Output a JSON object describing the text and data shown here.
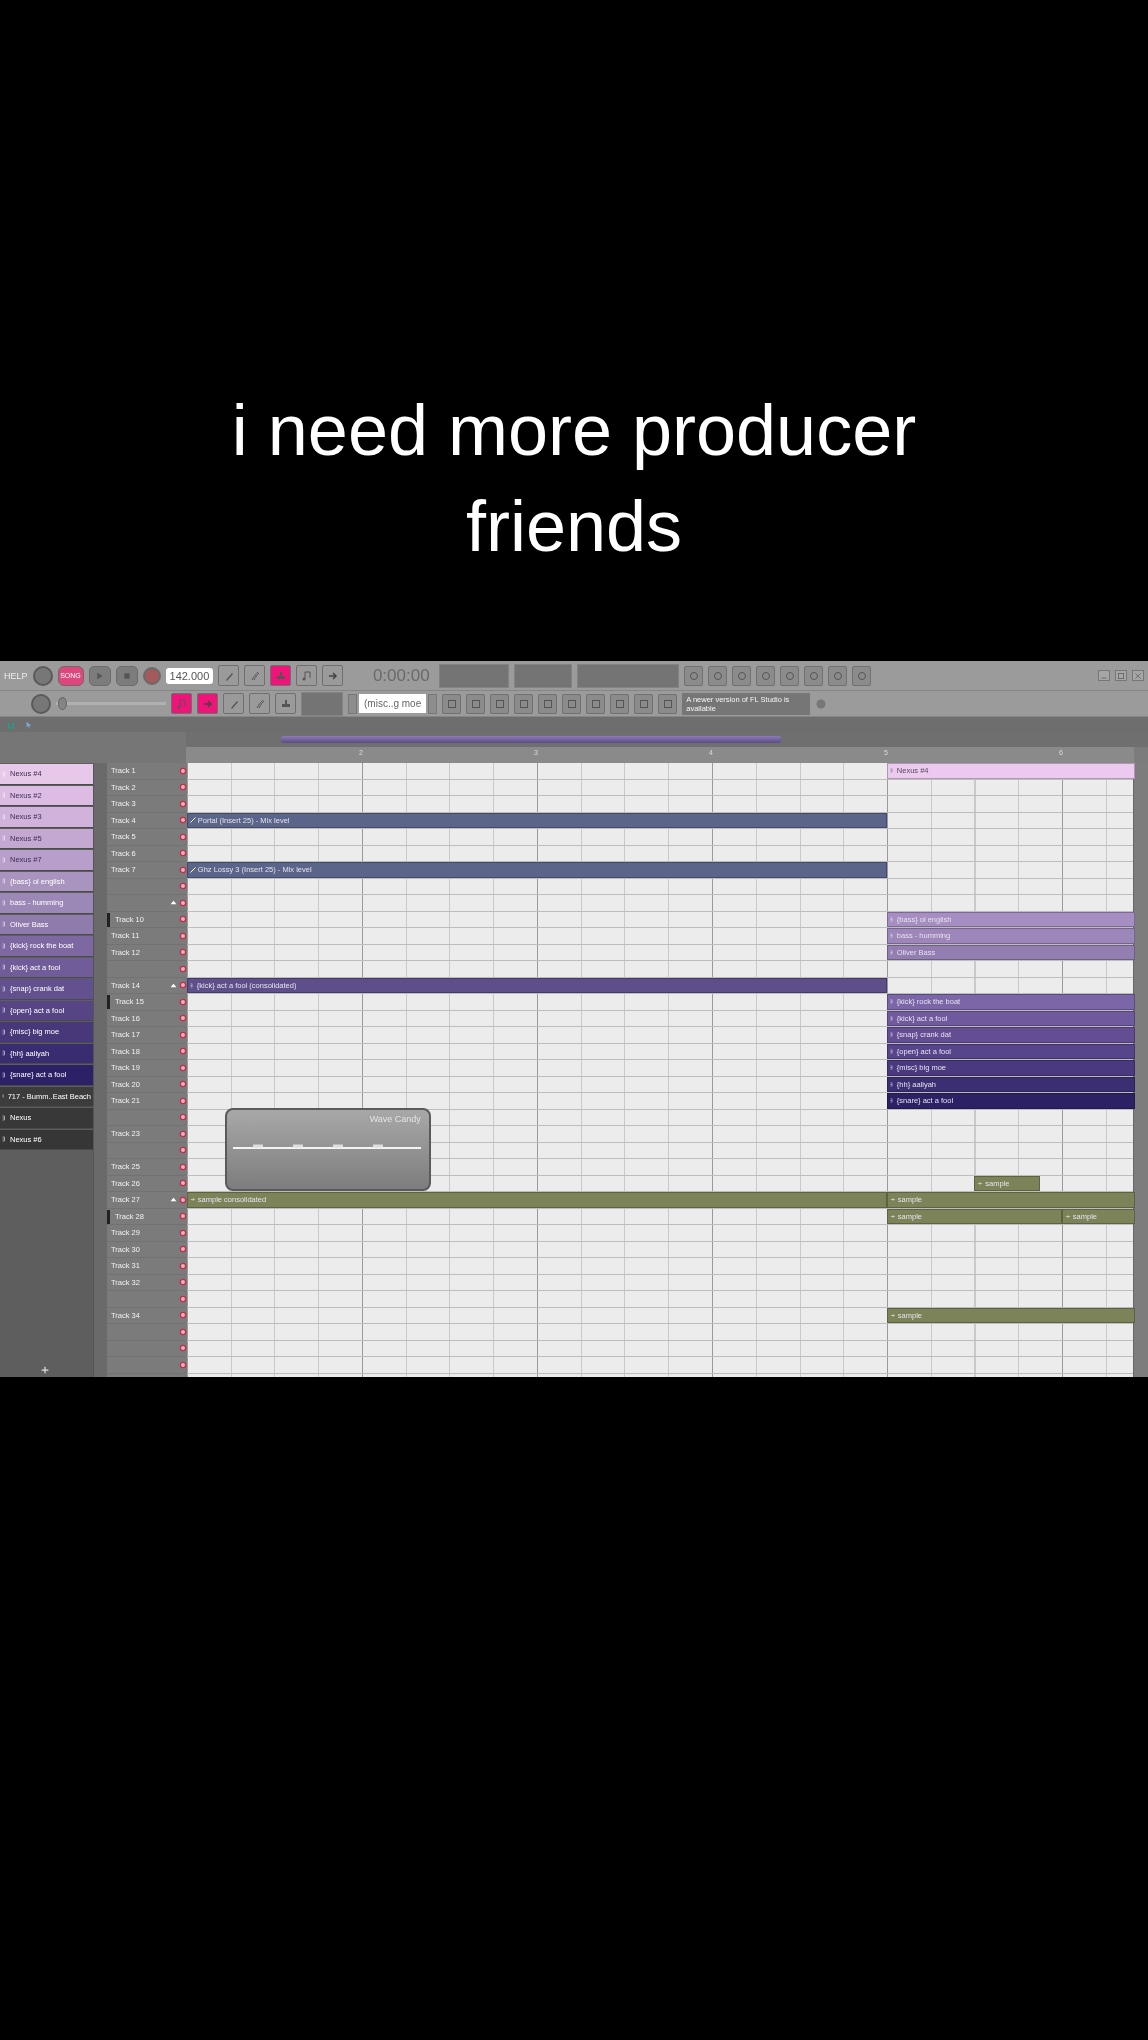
{
  "caption": "i need more producer friends",
  "toolbar": {
    "help": "HELP",
    "mode": "SONG",
    "tempo": "142.000",
    "time": "0:00:00",
    "pattern": "(misc..g moe",
    "notice": "A newer version of FL Studio is available",
    "master_slider": {
      "level": 0.02
    },
    "tools_top": [
      {
        "selected": false
      },
      {
        "selected": false
      },
      {
        "selected": true
      },
      {
        "selected": false
      },
      {
        "selected": false
      }
    ],
    "tools_bottom": [
      {
        "selected": true
      },
      {
        "selected": true
      },
      {
        "selected": false
      },
      {
        "selected": false
      },
      {
        "selected": false
      }
    ]
  },
  "ruler": [
    "2",
    "3",
    "4",
    "5",
    "6"
  ],
  "channels": [
    {
      "name": "Nexus #4",
      "color": "#e8c8ea"
    },
    {
      "name": "Nexus #2",
      "color": "#dcbce2"
    },
    {
      "name": "Nexus #3",
      "color": "#d0b2da"
    },
    {
      "name": "Nexus #5",
      "color": "#c4a8d2"
    },
    {
      "name": "Nexus #7",
      "color": "#b89eca"
    },
    {
      "name": "{bass} ol english",
      "color": "#a994c0"
    },
    {
      "name": "bass - humming",
      "color": "#9c88b6"
    },
    {
      "name": "Oliver Bass",
      "color": "#8f7cac"
    },
    {
      "name": "{kick} rock the boat",
      "color": "#7d68a2"
    },
    {
      "name": "{kick} act a fool",
      "color": "#705c98"
    },
    {
      "name": "{snap} crank dat",
      "color": "#63508e"
    },
    {
      "name": "{open} act a fool",
      "color": "#564484"
    },
    {
      "name": "{misc} big moe",
      "color": "#48387a"
    },
    {
      "name": "{hh} aaliyah",
      "color": "#3a2c70"
    },
    {
      "name": "{snare} act a fool",
      "color": "#2c2066"
    },
    {
      "name": "717 - Bumm..East Beach",
      "color": "#3c3c3c"
    },
    {
      "name": "Nexus",
      "color": "#383838"
    },
    {
      "name": "Nexus #6",
      "color": "#363636"
    }
  ],
  "tracks": [
    {
      "name": "Track 1",
      "arrow": false,
      "grouped": false,
      "clips": [
        {
          "kind": "pattern",
          "label": "Nexus #4",
          "color": "#ecc9ee"
        }
      ]
    },
    {
      "name": "Track 2",
      "arrow": false,
      "grouped": false
    },
    {
      "name": "Track 3",
      "arrow": false,
      "grouped": false
    },
    {
      "name": "Track 4",
      "arrow": false,
      "grouped": false,
      "clips": [
        {
          "kind": "automation",
          "label": "Portal (Insert 25) - Mix level",
          "color": "#5a6589"
        }
      ]
    },
    {
      "name": "Track 5",
      "arrow": false,
      "grouped": false
    },
    {
      "name": "Track 6",
      "arrow": false,
      "grouped": false
    },
    {
      "name": "Track 7",
      "arrow": false,
      "grouped": false,
      "clips": [
        {
          "kind": "automation",
          "label": "Ghz Lossy 3 (Insert 25) - Mix level",
          "color": "#5a6589"
        }
      ]
    },
    {
      "arrow": false,
      "grouped": false
    },
    {
      "arrow": true,
      "grouped": false
    },
    {
      "name": "Track 10",
      "arrow": false,
      "grouped": true,
      "clips": [
        {
          "kind": "pattern",
          "label": "{bass} ol english",
          "color": "#a68ec2"
        }
      ]
    },
    {
      "name": "Track 11",
      "arrow": false,
      "grouped": false,
      "clips": [
        {
          "kind": "pattern",
          "label": "bass - humming",
          "color": "#9d86ba"
        }
      ]
    },
    {
      "name": "Track 12",
      "arrow": false,
      "grouped": false,
      "clips": [
        {
          "kind": "pattern",
          "label": "Oliver Bass",
          "color": "#937eb2"
        }
      ]
    },
    {
      "arrow": false,
      "grouped": false
    },
    {
      "name": "Track 14",
      "arrow": true,
      "grouped": false,
      "clips": [
        {
          "kind": "pattern",
          "label": "{kick} act a fool (consolidated)",
          "color": "#5e4f8a"
        }
      ]
    },
    {
      "name": "Track 15",
      "arrow": false,
      "grouped": true,
      "clips": [
        {
          "kind": "pattern",
          "label": "{kick} rock the boat",
          "color": "#7b66a8"
        }
      ]
    },
    {
      "name": "Track 16",
      "arrow": false,
      "grouped": false,
      "clips": [
        {
          "kind": "pattern",
          "label": "{kick} act a fool",
          "color": "#6f5a9e"
        }
      ]
    },
    {
      "name": "Track 17",
      "arrow": false,
      "grouped": false,
      "clips": [
        {
          "kind": "pattern",
          "label": "{snap} crank dat",
          "color": "#634e94"
        }
      ]
    },
    {
      "name": "Track 18",
      "arrow": false,
      "grouped": false,
      "clips": [
        {
          "kind": "pattern",
          "label": "{open} act a fool",
          "color": "#57448a"
        }
      ]
    },
    {
      "name": "Track 19",
      "arrow": false,
      "grouped": false,
      "clips": [
        {
          "kind": "pattern",
          "label": "{misc} big moe",
          "color": "#4a397e"
        }
      ]
    },
    {
      "name": "Track 20",
      "arrow": false,
      "grouped": false,
      "clips": [
        {
          "kind": "pattern",
          "label": "{hh} aaliyah",
          "color": "#3c2e72"
        }
      ]
    },
    {
      "name": "Track 21",
      "arrow": false,
      "grouped": false,
      "clips": [
        {
          "kind": "pattern",
          "label": "{snare} act a fool",
          "color": "#2c2164"
        }
      ]
    },
    {
      "arrow": false,
      "grouped": false
    },
    {
      "name": "Track 23",
      "arrow": false,
      "grouped": false
    },
    {
      "arrow": false,
      "grouped": false
    },
    {
      "name": "Track 25",
      "arrow": false,
      "grouped": false
    },
    {
      "name": "Track 26",
      "arrow": false,
      "grouped": false,
      "clips": [
        {
          "kind": "audio",
          "label": "sample",
          "color": "#7c8358"
        }
      ]
    },
    {
      "name": "Track 27",
      "arrow": true,
      "grouped": false,
      "clips": [
        {
          "kind": "audio",
          "label": "sample consolidated",
          "color": "#7c8358"
        },
        {
          "kind": "audio",
          "label": "sample",
          "color": "#7c8358"
        }
      ]
    },
    {
      "name": "Track 28",
      "arrow": false,
      "grouped": true,
      "clips": [
        {
          "kind": "audio",
          "label": "sample",
          "color": "#7c8358"
        },
        {
          "kind": "audio",
          "label": "sample",
          "color": "#7c8358"
        }
      ]
    },
    {
      "name": "Track 29",
      "arrow": false,
      "grouped": false
    },
    {
      "name": "Track 30",
      "arrow": false,
      "grouped": false
    },
    {
      "name": "Track 31",
      "arrow": false,
      "grouped": false
    },
    {
      "name": "Track 32",
      "arrow": false,
      "grouped": false
    },
    {
      "arrow": false,
      "grouped": false
    },
    {
      "name": "Track 34",
      "arrow": false,
      "grouped": false,
      "clips": [
        {
          "kind": "audio",
          "label": "sample",
          "color": "#7c8358"
        }
      ]
    },
    {
      "arrow": false,
      "grouped": false
    },
    {
      "arrow": false,
      "grouped": false
    },
    {
      "arrow": false,
      "grouped": false
    }
  ],
  "plugin_window": {
    "title": "Wave Candy"
  }
}
